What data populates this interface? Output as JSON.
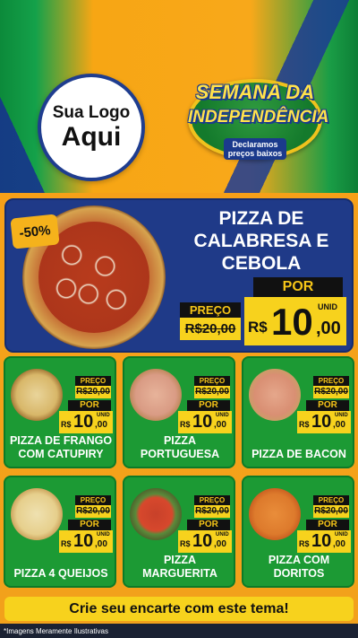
{
  "header": {
    "logo_line1": "Sua Logo",
    "logo_line2": "Aqui",
    "seal_title1": "SEMANA DA",
    "seal_title2": "INDEPENDÊNCIA",
    "seal_sub": "Declaramos preços baixos"
  },
  "featured": {
    "discount": "-50%",
    "name_line1": "PIZZA DE",
    "name_line2": "CALABRESA E",
    "name_line3": "CEBOLA",
    "preco_label": "PREÇO",
    "old_price": "R$20,00",
    "por_label": "POR",
    "currency": "R$",
    "price_int": "10",
    "price_dec": ",00",
    "unid": "UNID"
  },
  "products": [
    {
      "name": "PIZZA DE FRANGO COM CATUPIRY",
      "preco_label": "PREÇO",
      "old_price": "R$20,00",
      "por_label": "POR",
      "currency": "R$",
      "price_int": "10",
      "price_dec": ",00",
      "unid": "UNID"
    },
    {
      "name": "PIZZA PORTUGUESA",
      "preco_label": "PREÇO",
      "old_price": "R$20,00",
      "por_label": "POR",
      "currency": "R$",
      "price_int": "10",
      "price_dec": ",00",
      "unid": "UNID"
    },
    {
      "name": "PIZZA DE BACON",
      "preco_label": "PREÇO",
      "old_price": "R$20,00",
      "por_label": "POR",
      "currency": "R$",
      "price_int": "10",
      "price_dec": ",00",
      "unid": "UNID"
    },
    {
      "name": "PIZZA 4 QUEIJOS",
      "preco_label": "PREÇO",
      "old_price": "R$20,00",
      "por_label": "POR",
      "currency": "R$",
      "price_int": "10",
      "price_dec": ",00",
      "unid": "UNID"
    },
    {
      "name": "PIZZA MARGUERITA",
      "preco_label": "PREÇO",
      "old_price": "R$20,00",
      "por_label": "POR",
      "currency": "R$",
      "price_int": "10",
      "price_dec": ",00",
      "unid": "UNID"
    },
    {
      "name": "PIZZA COM DORITOS",
      "preco_label": "PREÇO",
      "old_price": "R$20,00",
      "por_label": "POR",
      "currency": "R$",
      "price_int": "10",
      "price_dec": ",00",
      "unid": "UNID"
    }
  ],
  "cta": "Crie seu encarte com este tema!",
  "footer_note": "*Imagens Meramente Ilustrativas",
  "colors": {
    "brand_green": "#1c9a34",
    "brand_blue": "#1f3a88",
    "price_yellow": "#f7d21d",
    "label_black": "#111111"
  }
}
